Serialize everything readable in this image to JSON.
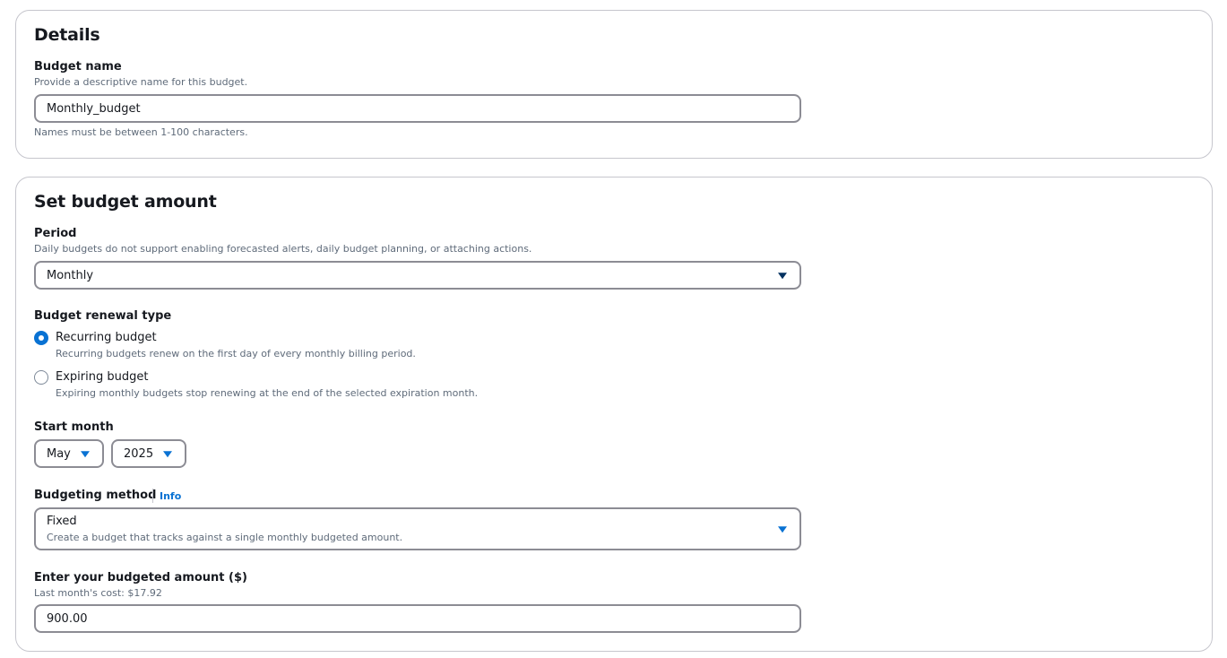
{
  "details": {
    "heading": "Details",
    "budget_name": {
      "label": "Budget name",
      "description": "Provide a descriptive name for this budget.",
      "value": "Monthly_budget",
      "constraint": "Names must be between 1-100 characters."
    }
  },
  "amount": {
    "heading": "Set budget amount",
    "period": {
      "label": "Period",
      "description": "Daily budgets do not support enabling forecasted alerts, daily budget planning, or attaching actions.",
      "value": "Monthly"
    },
    "renewal": {
      "label": "Budget renewal type",
      "options": [
        {
          "label": "Recurring budget",
          "description": "Recurring budgets renew on the first day of every monthly billing period.",
          "selected": true
        },
        {
          "label": "Expiring budget",
          "description": "Expiring monthly budgets stop renewing at the end of the selected expiration month.",
          "selected": false
        }
      ]
    },
    "start_month": {
      "label": "Start month",
      "month": "May",
      "year": "2025"
    },
    "method": {
      "label": "Budgeting method",
      "info": "Info",
      "value": "Fixed",
      "value_description": "Create a budget that tracks against a single monthly budgeted amount."
    },
    "budgeted_amount": {
      "label": "Enter your budgeted amount ($)",
      "description": "Last month's cost: $17.92",
      "value": "900.00"
    }
  },
  "colors": {
    "accent": "#0972d3",
    "border": "#8c8c94",
    "panel_border": "#c6c6cd",
    "text": "#16191f",
    "muted": "#5f6b7a"
  }
}
